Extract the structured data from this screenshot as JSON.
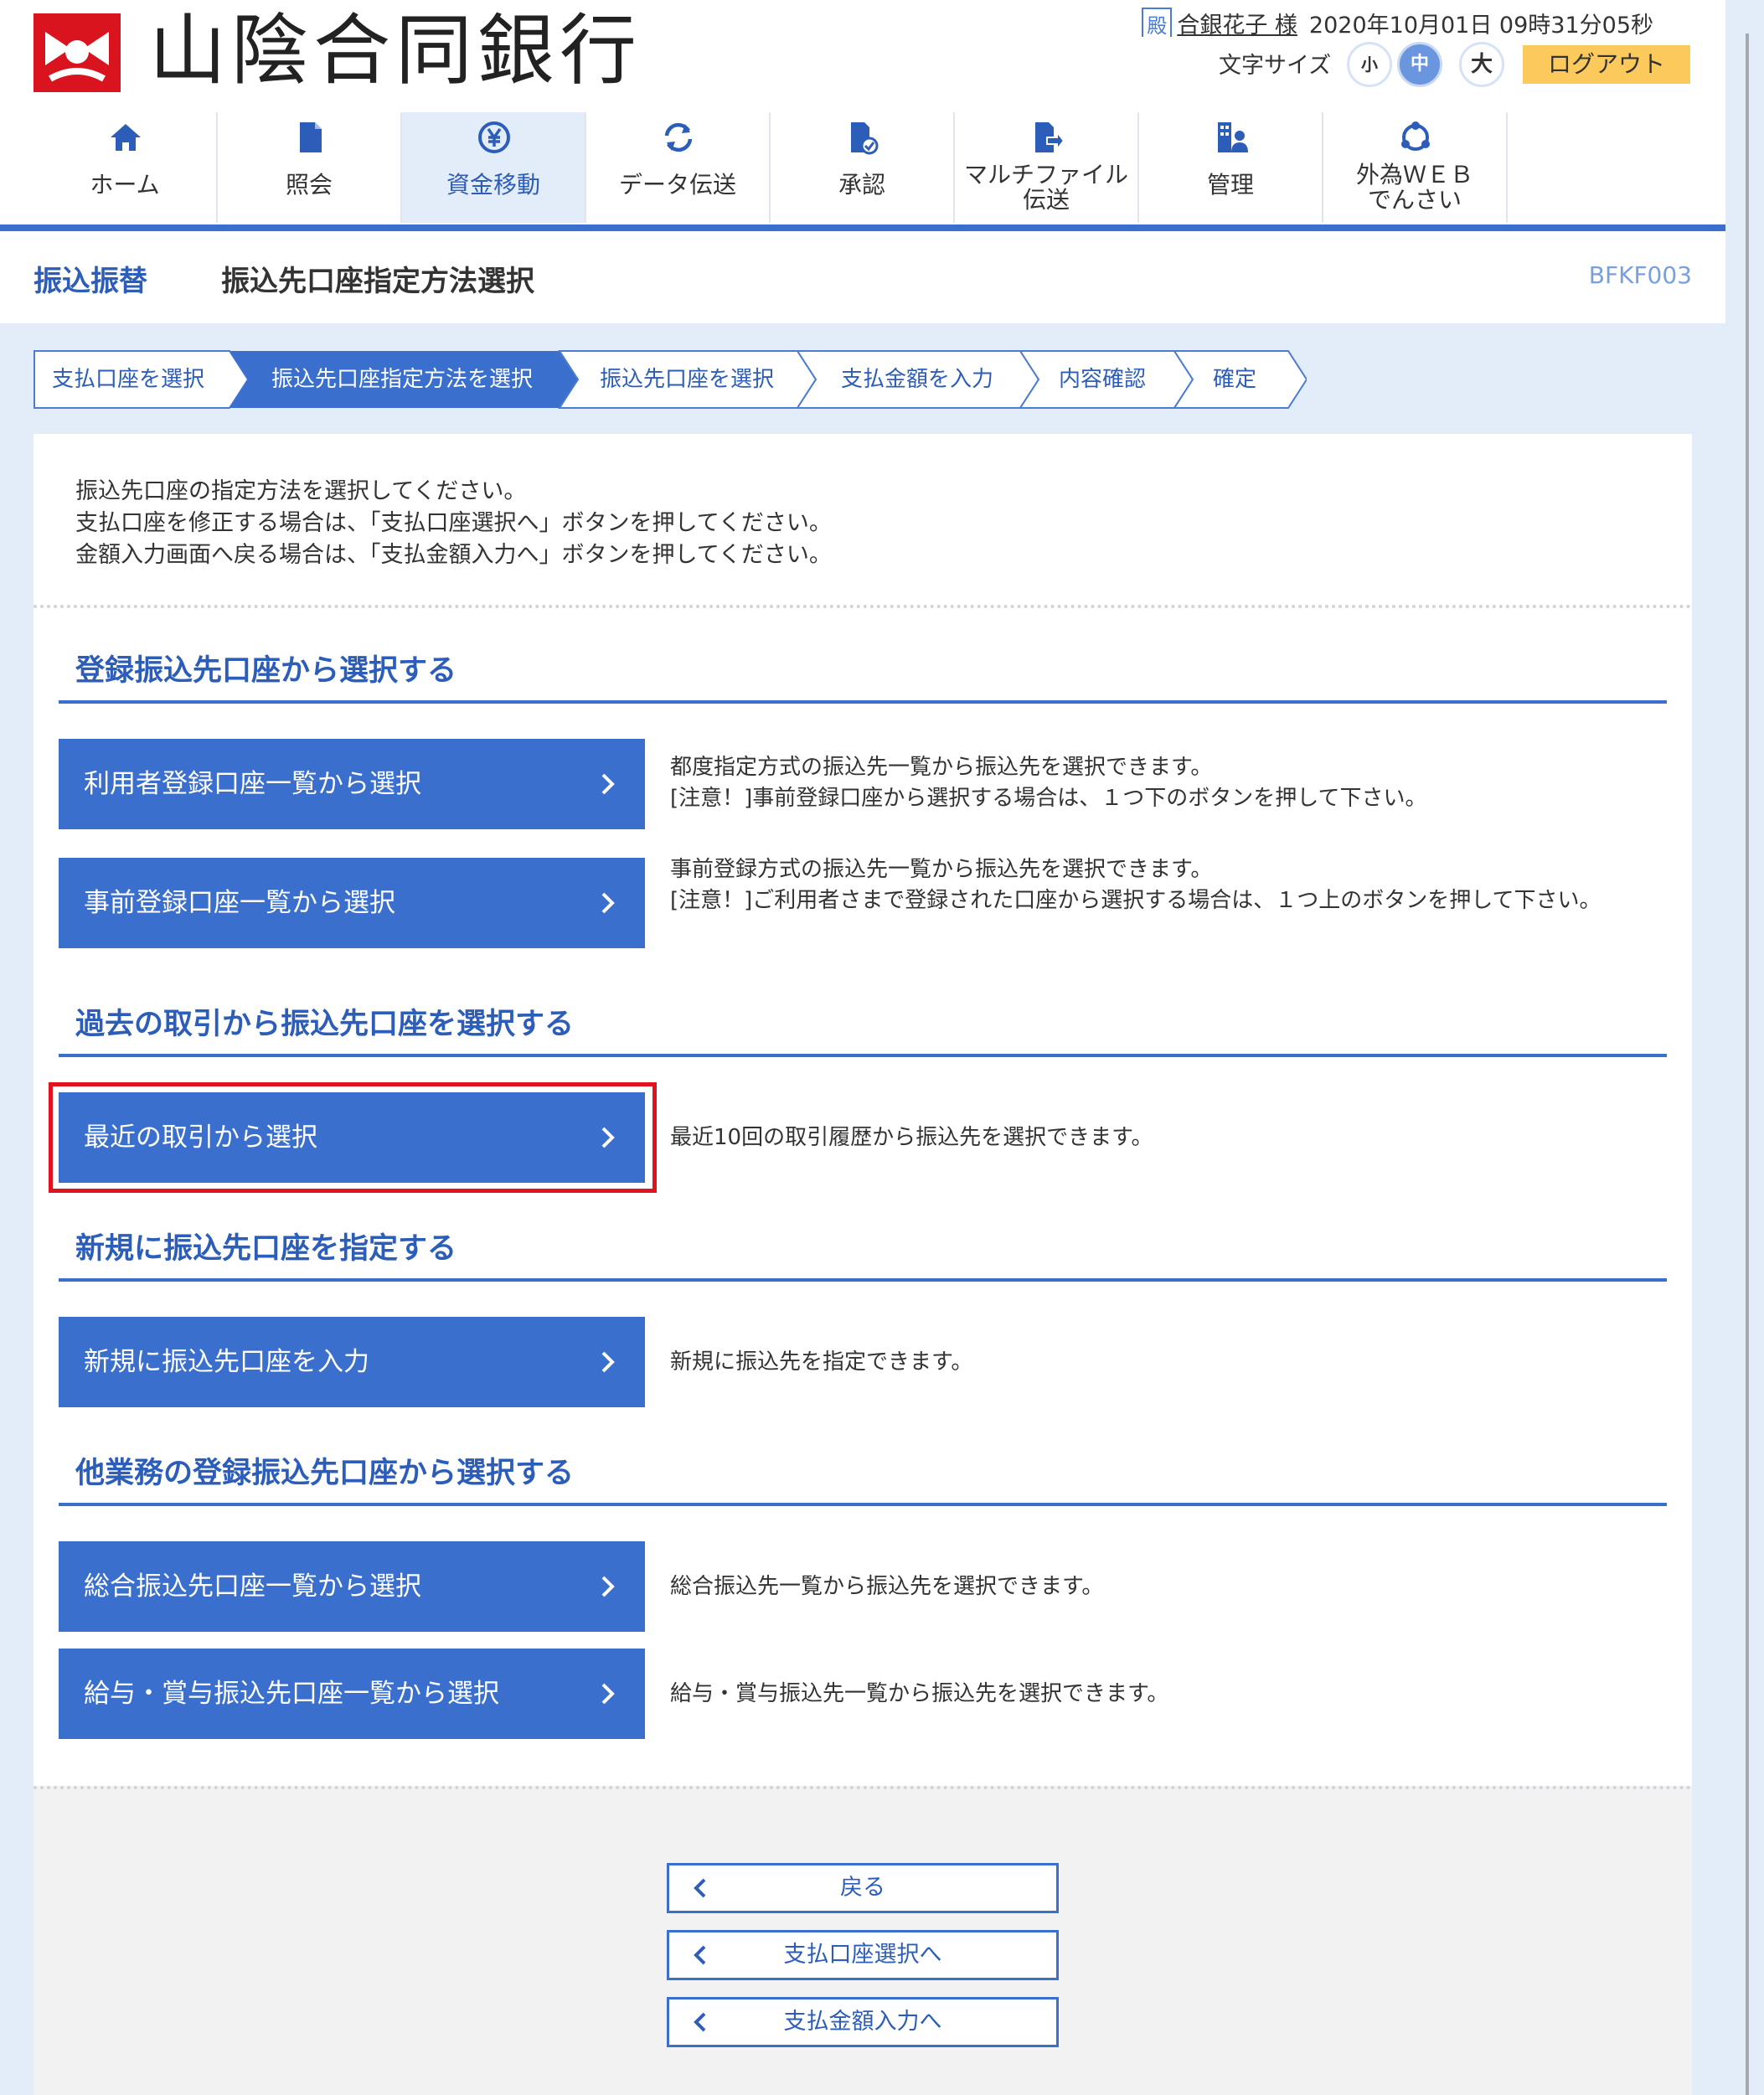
{
  "header": {
    "bank_name": "山陰合同銀行",
    "user_badge": "殿",
    "user_name": "合銀花子 様",
    "datetime": "2020年10月01日 09時31分05秒",
    "font_size_label": "文字サイズ",
    "font_small": "小",
    "font_medium": "中",
    "font_large": "大",
    "logout": "ログアウト"
  },
  "nav": {
    "items": [
      {
        "label": "ホーム",
        "icon": "home-icon"
      },
      {
        "label": "照会",
        "icon": "document-icon"
      },
      {
        "label": "資金移動",
        "icon": "yen-transfer-icon",
        "active": true
      },
      {
        "label": "データ伝送",
        "icon": "sync-icon"
      },
      {
        "label": "承認",
        "icon": "approve-icon"
      },
      {
        "label": "マルチファイル",
        "label2": "伝送",
        "icon": "file-send-icon"
      },
      {
        "label": "管理",
        "icon": "admin-icon"
      },
      {
        "label": "外為ＷＥＢ",
        "label2": "でんさい",
        "icon": "forex-icon"
      }
    ]
  },
  "title": {
    "section": "振込振替",
    "page": "振込先口座指定方法選択",
    "screen_id": "BFKF003"
  },
  "steps": [
    "支払口座を選択",
    "振込先口座指定方法を選択",
    "振込先口座を選択",
    "支払金額を入力",
    "内容確認",
    "確定"
  ],
  "intro": {
    "line1": "振込先口座の指定方法を選択してください。",
    "line2": "支払口座を修正する場合は、「支払口座選択へ」ボタンを押してください。",
    "line3": "金額入力画面へ戻る場合は、「支払金額入力へ」ボタンを押してください。"
  },
  "sections": {
    "registered": {
      "heading": "登録振込先口座から選択する",
      "user_list_button": "利用者登録口座一覧から選択",
      "user_list_desc1": "都度指定方式の振込先一覧から振込先を選択できます。",
      "user_list_desc2": "[注意！]事前登録口座から選択する場合は、１つ下のボタンを押して下さい。",
      "pre_list_button": "事前登録口座一覧から選択",
      "pre_list_desc1": "事前登録方式の振込先一覧から振込先を選択できます。",
      "pre_list_desc2": "[注意！]ご利用者さまで登録された口座から選択する場合は、１つ上のボタンを押して下さい。"
    },
    "history": {
      "heading": "過去の取引から振込先口座を選択する",
      "button": "最近の取引から選択",
      "desc": "最近10回の取引履歴から振込先を選択できます。"
    },
    "new": {
      "heading": "新規に振込先口座を指定する",
      "button": "新規に振込先口座を入力",
      "desc": "新規に振込先を指定できます。"
    },
    "other": {
      "heading": "他業務の登録振込先口座から選択する",
      "general_button": "総合振込先口座一覧から選択",
      "general_desc": "総合振込先一覧から振込先を選択できます。",
      "salary_button": "給与・賞与振込先口座一覧から選択",
      "salary_desc": "給与・賞与振込先一覧から振込先を選択できます。"
    }
  },
  "footer": {
    "back": "戻る",
    "to_payment_account": "支払口座選択へ",
    "to_amount": "支払金額入力へ"
  },
  "colors": {
    "primary": "#3a6fcd",
    "logo_red": "#d9141f",
    "logout_bg": "#fcca5c",
    "highlight": "#e0141e"
  }
}
